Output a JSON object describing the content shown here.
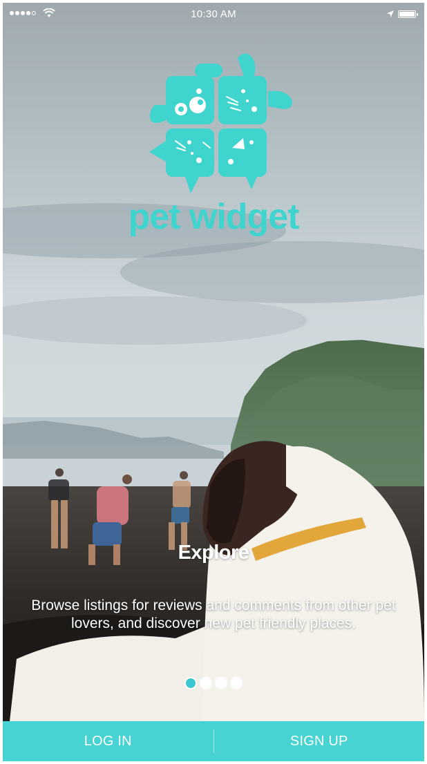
{
  "status_bar": {
    "time": "10:30 AM"
  },
  "brand": {
    "name": "pet widget",
    "color": "#40d4cf",
    "logo_icon": "pet-widget-logo-icon"
  },
  "slide": {
    "title": "Explore",
    "description": "Browse listings for reviews and comments from other pet lovers, and discover new pet friendly places."
  },
  "pager": {
    "total": 4,
    "active_index": 0,
    "active_color": "#3cc6cf"
  },
  "actions": {
    "login_label": "LOG IN",
    "signup_label": "SIGN UP",
    "bar_color": "#46d3d1"
  }
}
